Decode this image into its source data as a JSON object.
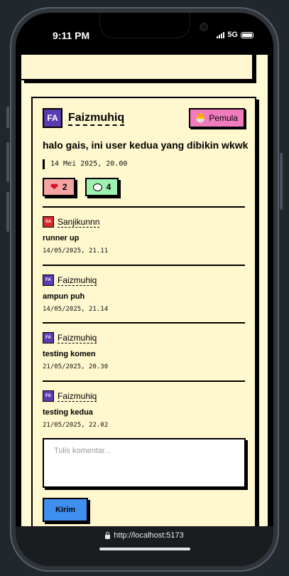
{
  "status_bar": {
    "time": "9:11 PM",
    "network": "5G"
  },
  "post": {
    "author": {
      "initials": "FA",
      "name": "Faizmuhiq"
    },
    "badge": {
      "icon": "🐣",
      "label": "Pemula"
    },
    "text": "halo gais, ini user kedua yang dibikin wkwk",
    "date": "14 Mei 2025, 20.00",
    "likes": "2",
    "comments_count": "4"
  },
  "comments": [
    {
      "initials": "SA",
      "user": "Sanjikunnn",
      "text": "runner up",
      "time": "14/05/2025, 21.11",
      "avatar_color": "#d42a2a"
    },
    {
      "initials": "FA",
      "user": "Faizmuhiq",
      "text": "ampun puh",
      "time": "14/05/2025, 21.14",
      "avatar_color": "#5b3cb0"
    },
    {
      "initials": "FA",
      "user": "Faizmuhiq",
      "text": "testing komen",
      "time": "21/05/2025, 20.30",
      "avatar_color": "#5b3cb0"
    },
    {
      "initials": "FA",
      "user": "Faizmuhiq",
      "text": "testing kedua",
      "time": "21/05/2025, 22.02",
      "avatar_color": "#5b3cb0"
    }
  ],
  "comment_form": {
    "placeholder": "Tulis komentar...",
    "submit_label": "Kirim"
  },
  "browser": {
    "url": "http://localhost:5173"
  },
  "colors": {
    "card_bg": "#fff7ce",
    "badge": "#f07bbf",
    "like": "#f5a3a3",
    "comment": "#9ef0b0",
    "submit": "#3f8ff0"
  }
}
